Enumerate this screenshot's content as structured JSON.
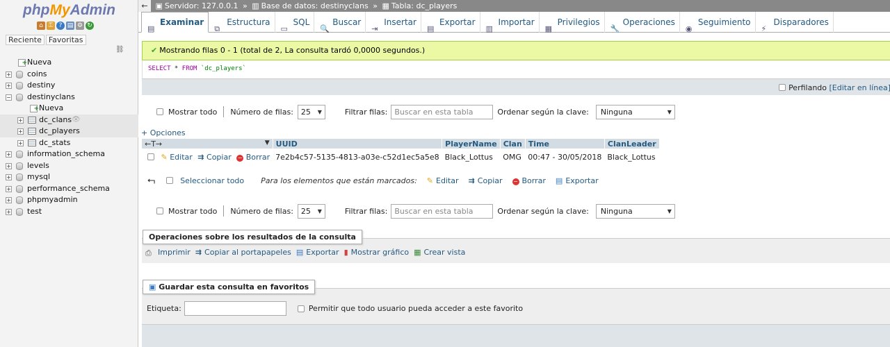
{
  "logo": {
    "php": "php",
    "my": "My",
    "admin": "Admin"
  },
  "nav": {
    "tabs": [
      "Reciente",
      "Favoritas"
    ],
    "tree": [
      {
        "label": "Nueva",
        "level": 0,
        "kind": "new"
      },
      {
        "label": "coins",
        "level": 0,
        "kind": "db"
      },
      {
        "label": "destiny",
        "level": 0,
        "kind": "db"
      },
      {
        "label": "destinyclans",
        "level": 0,
        "kind": "db",
        "expanded": true
      },
      {
        "label": "Nueva",
        "level": 1,
        "kind": "new"
      },
      {
        "label": "dc_clans",
        "level": 1,
        "kind": "table"
      },
      {
        "label": "dc_players",
        "level": 1,
        "kind": "table"
      },
      {
        "label": "dc_stats",
        "level": 1,
        "kind": "table"
      },
      {
        "label": "information_schema",
        "level": 0,
        "kind": "db"
      },
      {
        "label": "levels",
        "level": 0,
        "kind": "db"
      },
      {
        "label": "mysql",
        "level": 0,
        "kind": "db"
      },
      {
        "label": "performance_schema",
        "level": 0,
        "kind": "db"
      },
      {
        "label": "phpmyadmin",
        "level": 0,
        "kind": "db"
      },
      {
        "label": "test",
        "level": 0,
        "kind": "db"
      }
    ]
  },
  "breadcrumb": {
    "server": "Servidor: 127.0.0.1",
    "database": "Base de datos: destinyclans",
    "table": "Tabla: dc_players",
    "sep": "»"
  },
  "tabs": [
    {
      "label": "Examinar",
      "icon": "browse-icon",
      "active": true
    },
    {
      "label": "Estructura",
      "icon": "structure-icon"
    },
    {
      "label": "SQL",
      "icon": "sql-icon"
    },
    {
      "label": "Buscar",
      "icon": "search-icon"
    },
    {
      "label": "Insertar",
      "icon": "insert-icon"
    },
    {
      "label": "Exportar",
      "icon": "export-icon"
    },
    {
      "label": "Importar",
      "icon": "import-icon"
    },
    {
      "label": "Privilegios",
      "icon": "privileges-icon"
    },
    {
      "label": "Operaciones",
      "icon": "wrench-icon"
    },
    {
      "label": "Seguimiento",
      "icon": "eye-icon"
    },
    {
      "label": "Disparadores",
      "icon": "triggers-icon"
    }
  ],
  "message": "Mostrando filas 0 - 1 (total de 2, La consulta tardó 0,0000 segundos.)",
  "sql": {
    "select": "SELECT",
    "star": " * ",
    "from": "FROM",
    "table": " `dc_players`"
  },
  "profiling": {
    "label": "Perfilando",
    "edit_link": "[Editar en línea]"
  },
  "filters": {
    "show_all": "Mostrar todo",
    "rows_label": "Número de filas:",
    "rows_value": "25",
    "filter_label": "Filtrar filas:",
    "filter_placeholder": "Buscar en esta tabla",
    "sort_label": "Ordenar según la clave:",
    "sort_value": "Ninguna"
  },
  "options_link": "+ Opciones",
  "table": {
    "arrows": "←T→",
    "columns": [
      "UUID",
      "PlayerName",
      "Clan",
      "Time",
      "ClanLeader"
    ],
    "rows": [
      {
        "actions": {
          "edit": "Editar",
          "copy": "Copiar",
          "delete": "Borrar"
        },
        "cells": [
          "7e2b4c57-5135-4813-a03e-c52d1ec5a5e8",
          "Black_Lottus",
          "OMG",
          "00:47 - 30/05/2018",
          "Black_Lottus"
        ]
      }
    ]
  },
  "bulk": {
    "select_all": "Seleccionar todo",
    "marked_text": "Para los elementos que están marcados:",
    "edit": "Editar",
    "copy": "Copiar",
    "delete": "Borrar",
    "export": "Exportar"
  },
  "query_ops": {
    "legend": "Operaciones sobre los resultados de la consulta",
    "print": "Imprimir",
    "copy_clipboard": "Copiar al portapapeles",
    "export": "Exportar",
    "chart": "Mostrar gráfico",
    "view": "Crear vista"
  },
  "bookmark": {
    "legend": "Guardar esta consulta en favoritos",
    "label": "Etiqueta:",
    "public": "Permitir que todo usuario pueda acceder a este favorito"
  },
  "colors": {
    "link": "#235a81",
    "success_bg": "#ebf8a4",
    "header_bg": "#d3dce3",
    "topbar": "#888888"
  }
}
